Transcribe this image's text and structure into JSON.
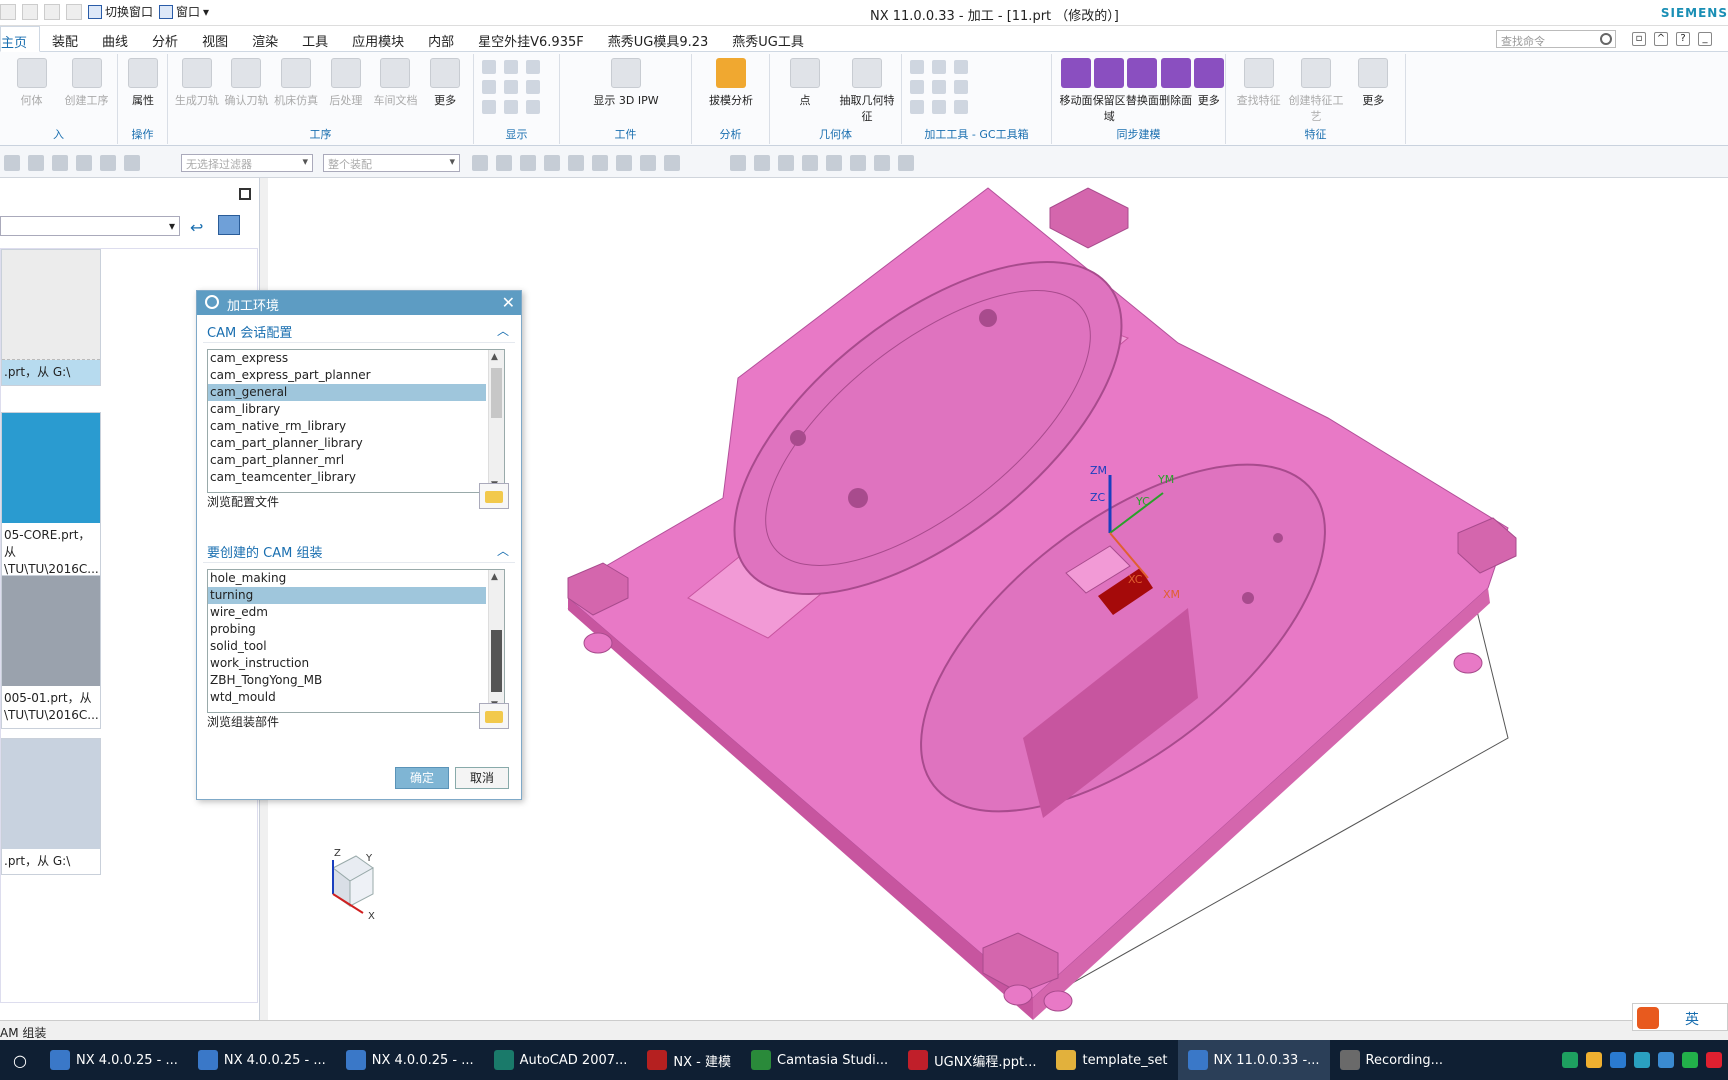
{
  "window": {
    "title": "NX 11.0.0.33 - 加工 - [11.prt （修改的）]",
    "brand": "SIEMENS",
    "switch_window": "切换窗口",
    "window_menu": "窗口"
  },
  "menu_tabs": [
    "主页",
    "装配",
    "曲线",
    "分析",
    "视图",
    "渲染",
    "工具",
    "应用模块",
    "内部",
    "星空外挂V6.935F",
    "燕秀UG模具9.23",
    "燕秀UG工具"
  ],
  "search": {
    "placeholder": "查找命令"
  },
  "ribbon": {
    "groups": [
      {
        "label": "入",
        "buttons": [
          "何体",
          "创建工序"
        ]
      },
      {
        "label": "操作",
        "buttons": [
          "属性"
        ]
      },
      {
        "label": "工序",
        "buttons": [
          "生成刀轨",
          "确认刀轨",
          "机床仿真",
          "后处理",
          "车间文档",
          "更多"
        ]
      },
      {
        "label": "显示",
        "buttons": []
      },
      {
        "label": "工件",
        "buttons": [
          "显示 3D IPW"
        ]
      },
      {
        "label": "分析",
        "buttons": [
          "拔模分析"
        ]
      },
      {
        "label": "几何体",
        "buttons": [
          "点",
          "抽取几何特征"
        ]
      },
      {
        "label": "加工工具 - GC工具箱",
        "buttons": []
      },
      {
        "label": "同步建模",
        "buttons": [
          "移动面",
          "保留区域",
          "替换面",
          "删除面",
          "更多"
        ]
      },
      {
        "label": "特征",
        "buttons": [
          "查找特征",
          "创建特征工艺",
          "更多"
        ]
      }
    ]
  },
  "selection_bar": {
    "filter": "无选择过滤器",
    "assembly": "整个装配"
  },
  "left_panel": {
    "cards": [
      {
        "caption": ".prt，从 G:\\"
      },
      {
        "caption": "05-CORE.prt，从 \\TU\\TU\\2016C..."
      },
      {
        "caption": "005-01.prt，从 \\TU\\TU\\2016C..."
      },
      {
        "caption": ".prt，从 G:\\"
      }
    ]
  },
  "dialog": {
    "title": "加工环境",
    "section1": {
      "header": "CAM 会话配置",
      "items": [
        "cam_express",
        "cam_express_part_planner",
        "cam_general",
        "cam_library",
        "cam_native_rm_library",
        "cam_part_planner_library",
        "cam_part_planner_mrl",
        "cam_teamcenter_library"
      ],
      "selected": "cam_general",
      "browse_label": "浏览配置文件"
    },
    "section2": {
      "header": "要创建的 CAM 组装",
      "items": [
        "hole_making",
        "turning",
        "wire_edm",
        "probing",
        "solid_tool",
        "work_instruction",
        "ZBH_TongYong_MB",
        "wtd_mould"
      ],
      "selected": "turning",
      "browse_label": "浏览组装部件"
    },
    "ok_label": "确定",
    "cancel_label": "取消"
  },
  "viewport": {
    "axis_labels": {
      "zm": "ZM",
      "zc": "ZC",
      "ym": "YM",
      "yc": "YC",
      "xc": "XC",
      "xm": "XM"
    },
    "triad": {
      "z": "Z",
      "y": "Y",
      "x": "X"
    },
    "colors": {
      "mold": "#e879c6",
      "mold_dark": "#c7559f",
      "highlight": "#a50a0a"
    }
  },
  "status_bar": {
    "text": "AM 组装"
  },
  "taskbar": {
    "items": [
      "NX 4.0.0.25 - ...",
      "NX 4.0.0.25 - ...",
      "NX 4.0.0.25 - ...",
      "AutoCAD 2007...",
      "NX - 建模",
      "Camtasia Studi...",
      "UGNX编程.ppt...",
      "template_set",
      "NX 11.0.0.33 -...",
      "Recording..."
    ],
    "active_index": 8
  },
  "ime": {
    "label": "英"
  }
}
